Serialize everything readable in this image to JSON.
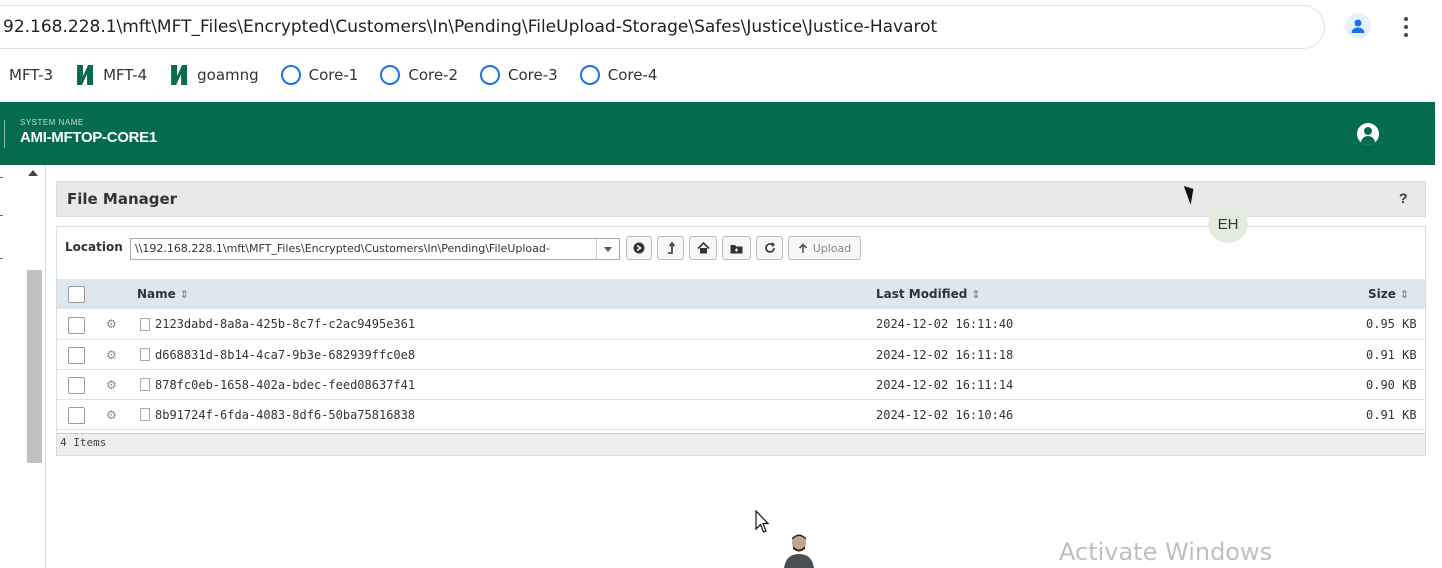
{
  "browser": {
    "url": "92.168.228.1\\mft\\MFT_Files\\Encrypted\\Customers\\In\\Pending\\FileUpload-Storage\\Safes\\Justice\\Justice-Havarot",
    "bookmarks": [
      {
        "label": "MFT-3",
        "icon": "none"
      },
      {
        "label": "MFT-4",
        "icon": "mft-logo-icon"
      },
      {
        "label": "goamng",
        "icon": "mft-logo-icon"
      },
      {
        "label": "Core-1",
        "icon": "ring-icon"
      },
      {
        "label": "Core-2",
        "icon": "ring-icon"
      },
      {
        "label": "Core-3",
        "icon": "ring-icon"
      },
      {
        "label": "Core-4",
        "icon": "ring-icon"
      }
    ]
  },
  "header": {
    "system_label": "SYSTEM NAME",
    "system_name": "AMI-MFTOP-CORE1",
    "accent_color": "#046b4e"
  },
  "file_manager": {
    "title": "File Manager",
    "help": "?",
    "location_label": "Location",
    "location_value": "\\\\192.168.228.1\\mft\\MFT_Files\\Encrypted\\Customers\\In\\Pending\\FileUpload-",
    "upload_label": "Upload",
    "columns": {
      "name": "Name",
      "modified": "Last Modified",
      "size": "Size"
    },
    "rows": [
      {
        "name": "2123dabd-8a8a-425b-8c7f-c2ac9495e361",
        "modified": "2024-12-02 16:11:40",
        "size": "0.95 KB"
      },
      {
        "name": "d668831d-8b14-4ca7-9b3e-682939ffc0e8",
        "modified": "2024-12-02 16:11:18",
        "size": "0.91 KB"
      },
      {
        "name": "878fc0eb-1658-402a-bdec-feed08637f41",
        "modified": "2024-12-02 16:11:14",
        "size": "0.90 KB"
      },
      {
        "name": "8b91724f-6fda-4083-8df6-50ba75816838",
        "modified": "2024-12-02 16:10:46",
        "size": "0.91 KB"
      }
    ],
    "footer": "4 Items"
  },
  "overlay": {
    "avatar_initials": "EH",
    "watermark": "Activate Windows"
  }
}
